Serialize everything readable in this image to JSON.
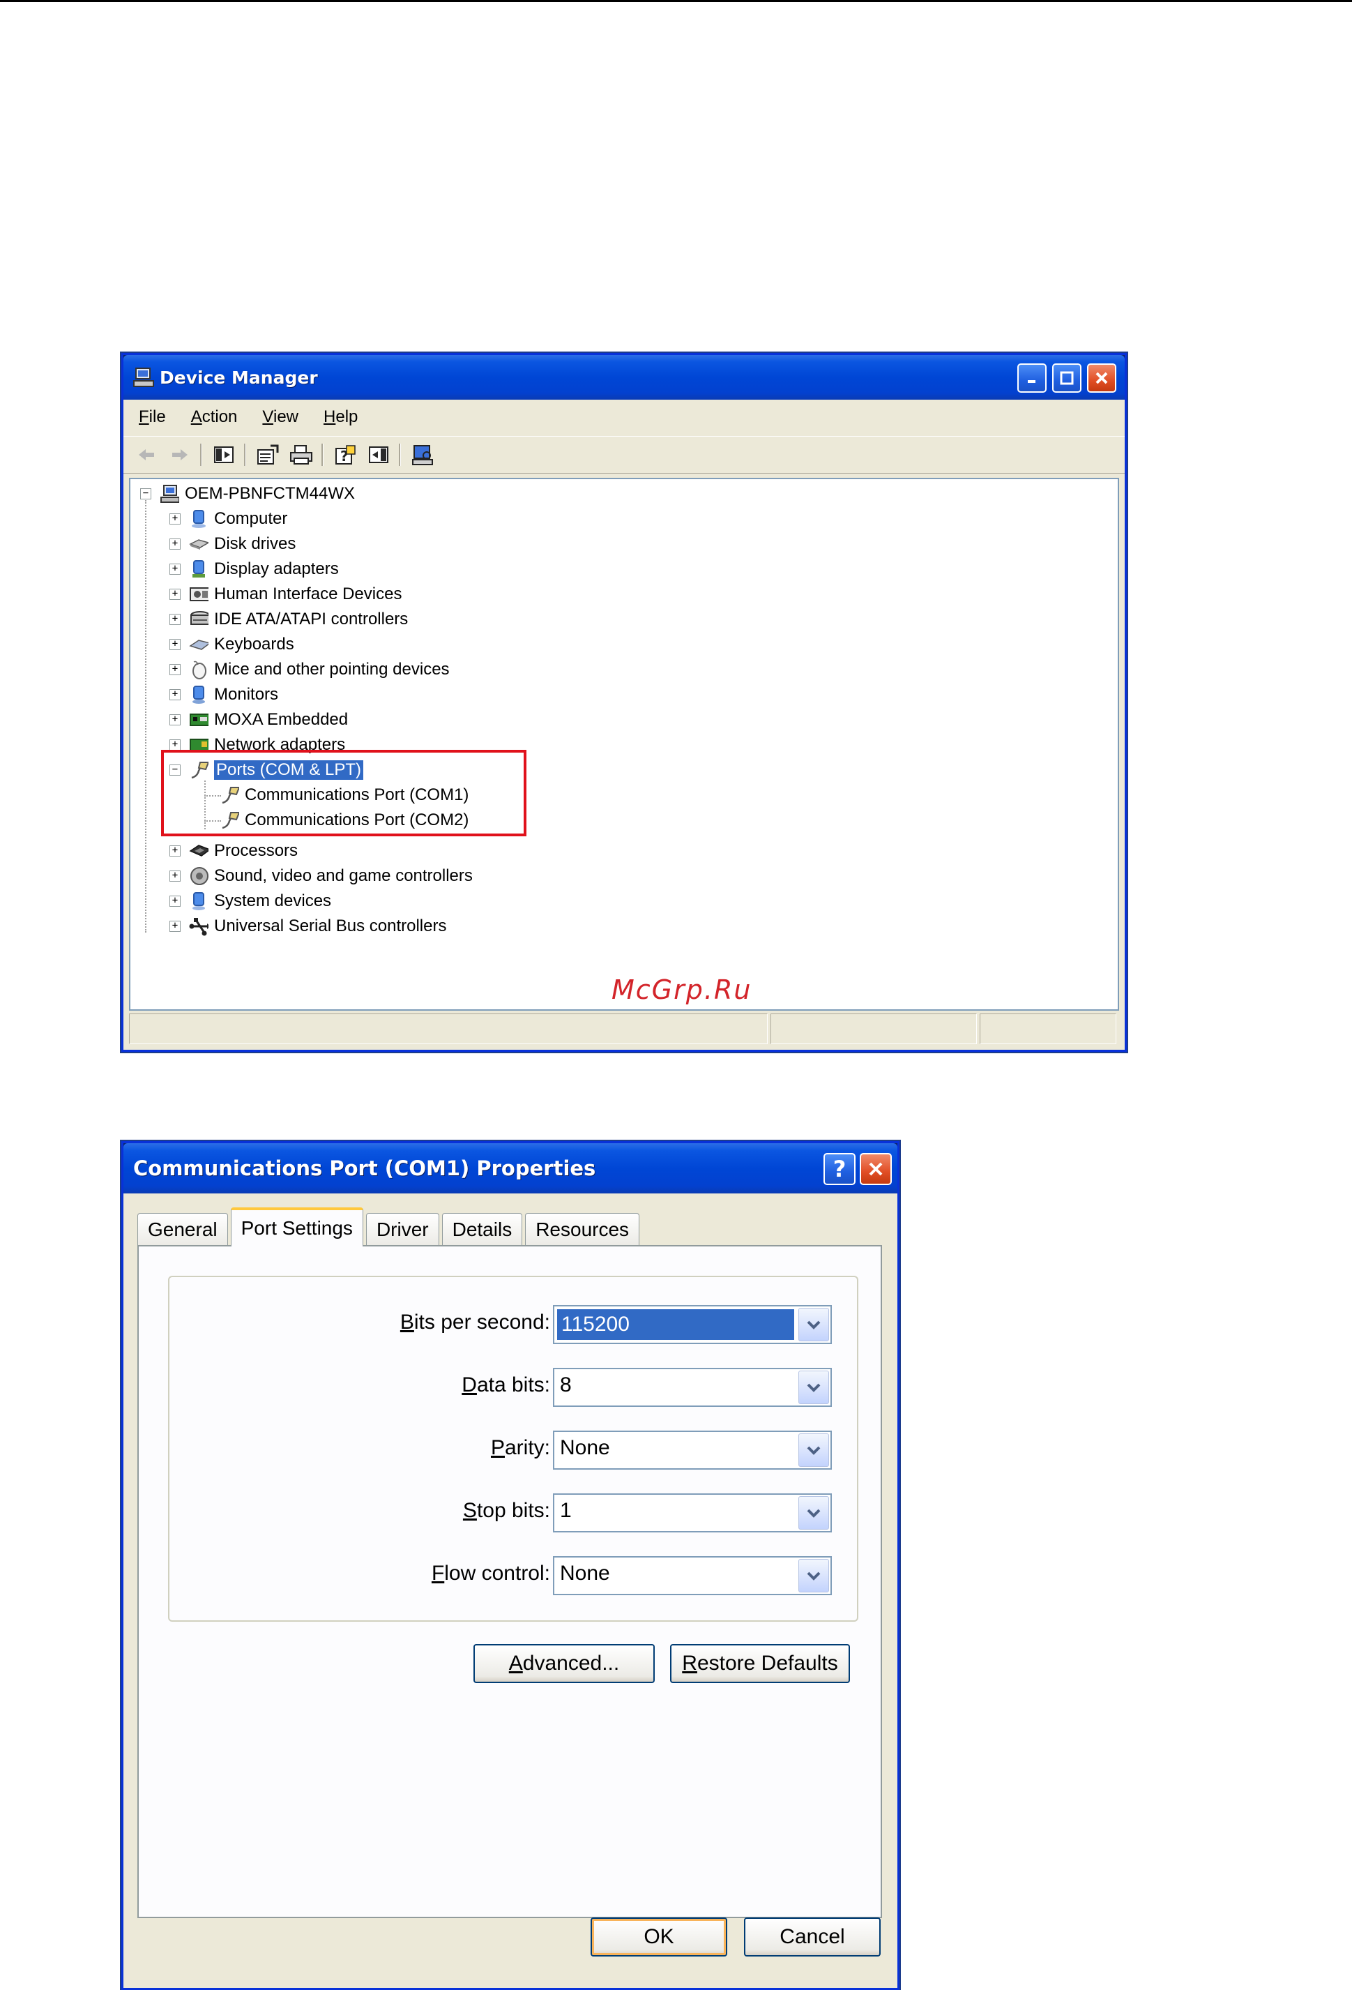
{
  "device_manager": {
    "title": "Device Manager",
    "menu": [
      {
        "label": "File",
        "accel": "F",
        "rest": "ile"
      },
      {
        "label": "Action",
        "accel": "A",
        "rest": "ction"
      },
      {
        "label": "View",
        "accel": "V",
        "rest": "iew"
      },
      {
        "label": "Help",
        "accel": "H",
        "rest": "elp"
      }
    ],
    "toolbar_icons": [
      "back-arrow-icon",
      "forward-arrow-icon",
      "show-hide-console-tree-icon",
      "properties-icon",
      "print-icon",
      "help-icon",
      "show-hide-action-pane-icon",
      "scan-hardware-icon"
    ],
    "tree": {
      "root": "OEM-PBNFCTM44WX",
      "categories": [
        {
          "label": "Computer",
          "icon": "computer-icon"
        },
        {
          "label": "Disk drives",
          "icon": "disk-drive-icon"
        },
        {
          "label": "Display adapters",
          "icon": "display-adapter-icon"
        },
        {
          "label": "Human Interface Devices",
          "icon": "hid-icon"
        },
        {
          "label": "IDE ATA/ATAPI controllers",
          "icon": "ide-controller-icon"
        },
        {
          "label": "Keyboards",
          "icon": "keyboard-icon"
        },
        {
          "label": "Mice and other pointing devices",
          "icon": "mouse-icon"
        },
        {
          "label": "Monitors",
          "icon": "monitor-icon"
        },
        {
          "label": "MOXA Embedded",
          "icon": "board-icon"
        },
        {
          "label": "Network adapters",
          "icon": "network-adapter-icon"
        },
        {
          "label": "Ports (COM & LPT)",
          "icon": "port-icon",
          "expanded": true,
          "selected": true,
          "children": [
            "Communications Port (COM1)",
            "Communications Port (COM2)"
          ]
        },
        {
          "label": "Processors",
          "icon": "processor-icon"
        },
        {
          "label": "Sound, video and game controllers",
          "icon": "sound-icon"
        },
        {
          "label": "System devices",
          "icon": "system-device-icon"
        },
        {
          "label": "Universal Serial Bus controllers",
          "icon": "usb-icon"
        }
      ]
    },
    "watermark": "McGrp.Ru"
  },
  "properties_dialog": {
    "title": "Communications Port (COM1) Properties",
    "tabs": [
      "General",
      "Port Settings",
      "Driver",
      "Details",
      "Resources"
    ],
    "active_tab": "Port Settings",
    "fields": [
      {
        "label": "Bits per second:",
        "accel": "B",
        "rest": "its per second:",
        "value": "115200",
        "selected": true
      },
      {
        "label": "Data bits:",
        "accel": "D",
        "rest": "ata bits:",
        "value": "8"
      },
      {
        "label": "Parity:",
        "accel": "P",
        "rest": "arity:",
        "value": "None"
      },
      {
        "label": "Stop bits:",
        "accel": "S",
        "rest": "top bits:",
        "value": "1"
      },
      {
        "label": "Flow control:",
        "accel": "F",
        "rest": "low control:",
        "value": "None"
      }
    ],
    "buttons": {
      "advanced": {
        "label": "Advanced...",
        "accel": "A",
        "rest": "dvanced..."
      },
      "restore_defaults": {
        "label": "Restore Defaults",
        "accel": "R",
        "rest": "estore Defaults"
      },
      "ok": "OK",
      "cancel": "Cancel"
    }
  }
}
